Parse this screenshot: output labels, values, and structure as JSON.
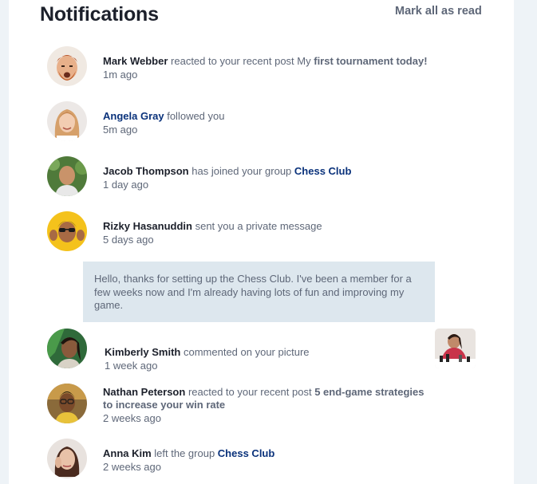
{
  "header": {
    "title": "Notifications",
    "mark_all_label": "Mark all as read"
  },
  "notifications": [
    {
      "name": "Mark Webber",
      "action": "reacted to your recent post My ",
      "target": "first tournament today!",
      "time": "1m ago",
      "avatar": "avatar-mark-webber"
    },
    {
      "name": "Angela Gray",
      "action": "followed you",
      "time": "5m ago",
      "avatar": "avatar-angela-gray"
    },
    {
      "name": "Jacob Thompson",
      "action": "has joined your group ",
      "target": "Chess Club",
      "time": "1 day ago",
      "avatar": "avatar-jacob-thompson"
    },
    {
      "name": "Rizky Hasanuddin",
      "action": "sent you a private message",
      "time": "5 days ago",
      "avatar": "avatar-rizky-hasanuddin",
      "message": "Hello, thanks for setting up the Chess Club. I've been a member for a few weeks now and I'm already having lots of fun and improving my game."
    },
    {
      "name": "Kimberly Smith",
      "action": "commented on your picture",
      "time": "1 week ago",
      "avatar": "avatar-kimberly-smith",
      "picture": "chess-picture"
    },
    {
      "name": "Nathan Peterson",
      "action": "reacted to your recent post ",
      "target_line1": "5 end-game strategies",
      "target_line2": "to increase your win rate",
      "time": "2 weeks ago",
      "avatar": "avatar-nathan-peterson"
    },
    {
      "name": "Anna Kim",
      "action": "left the group ",
      "target": "Chess Club",
      "time": "2 weeks ago",
      "avatar": "avatar-anna-kim"
    }
  ],
  "colors": {
    "title": "#1c202b",
    "text": "#5e6778",
    "link_blue": "#0a327b",
    "message_bg": "#dde7ee",
    "page_bg": "#eef3f7"
  }
}
